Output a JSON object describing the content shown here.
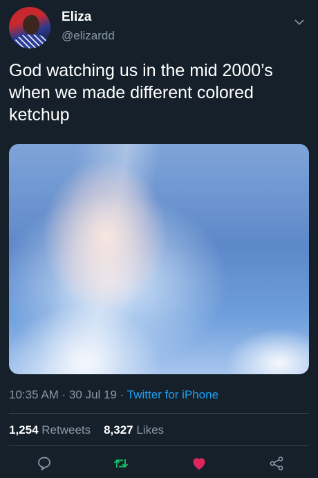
{
  "user": {
    "name": "Eliza",
    "handle": "@elizardd"
  },
  "tweet": {
    "text": "God watching us in the mid 2000’s when we made different colored ketchup"
  },
  "meta": {
    "time": "10:35 AM",
    "sep1": " · ",
    "date": "30 Jul 19",
    "sep2": " · ",
    "source": "Twitter for iPhone"
  },
  "stats": {
    "retweets_count": "1,254",
    "retweets_label": "Retweets",
    "likes_count": "8,327",
    "likes_label": "Likes"
  },
  "icons": {
    "chevron": "chevron-down-icon",
    "reply": "reply-icon",
    "retweet": "retweet-icon",
    "like": "heart-icon",
    "share": "share-icon"
  },
  "colors": {
    "background": "#15202b",
    "muted": "#8899a6",
    "link": "#1da1f2",
    "retweet": "#17bf63",
    "like": "#e0245e"
  }
}
